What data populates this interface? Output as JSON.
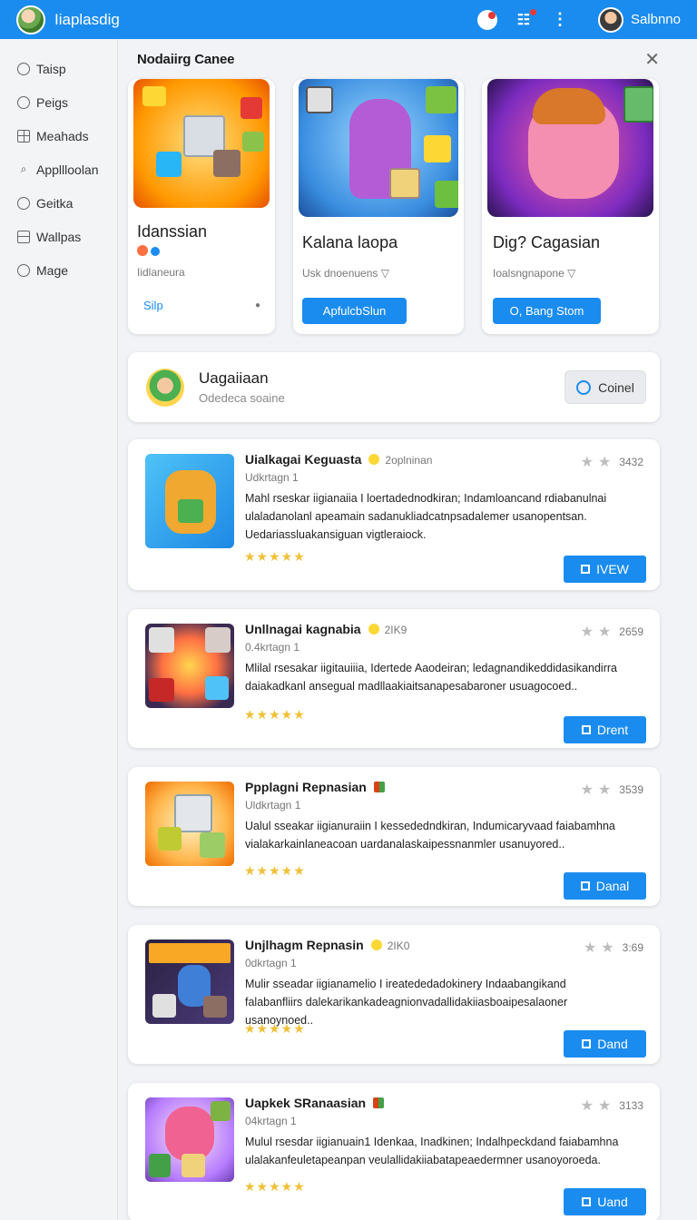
{
  "topbar": {
    "app_title": "Iiaplasdig",
    "user_name": "Salbnno"
  },
  "sidebar": {
    "items": [
      {
        "label": "Taisp",
        "icon": "clock-icon"
      },
      {
        "label": "Peigs",
        "icon": "circle-icon"
      },
      {
        "label": "Meahads",
        "icon": "grid-icon"
      },
      {
        "label": "Appllloolan",
        "icon": "search-icon"
      },
      {
        "label": "Geitka",
        "icon": "pie-icon"
      },
      {
        "label": "Wallpas",
        "icon": "window-icon"
      },
      {
        "label": "Mage",
        "icon": "circle-icon"
      }
    ]
  },
  "featured": {
    "title": "Nodaiirg Canee",
    "cards": [
      {
        "name": "Idanssian",
        "sub": "Iidlaneura",
        "action": "Silp"
      },
      {
        "name": "Kalana laopa",
        "sub": "Usk dnoenuens ▽",
        "action": "ApfulcbSlun"
      },
      {
        "name": "Dig? Cagasian",
        "sub": "Ioalsngnapone ▽",
        "action": "O, Bang Stom"
      }
    ]
  },
  "promo": {
    "title": "Uagaiiaan",
    "sub": "Odedeca soaine",
    "button": "Coinel"
  },
  "list": [
    {
      "title": "Uialkagai Keguasta",
      "meta": "2oplninan",
      "score": "3432",
      "sub": "Udkrtagn 1",
      "desc": "Mahl rseskar iigianaiia I loertadednodkiran; Indamloancand rdiabanulnai ulaladanolanl apeamain sadanukliadcatnpsadalemer usanopentsan. Uedariassluakansiguan vigtleraiock.",
      "stars": "★★★★★",
      "button": "IVEW"
    },
    {
      "title": "Unllnagai kagnabia",
      "meta": "2IK9",
      "score": "2659",
      "sub": "0.4krtagn 1",
      "desc": "Mlilal rsesakar iigitauiiia, Idertede Aaodeiran; ledagnandikeddidasikandirra daiakadkanl ansegual madllaakiaitsanapesabaroner usuagocoed..",
      "stars": "★★★★★",
      "button": "Drent"
    },
    {
      "title": "Ppplagni Repnasian",
      "meta": "",
      "score": "3539",
      "sub": "Uldkrtagn 1",
      "desc": "Ualul sseakar iigianuraiin I kessededndkiran, Indumicaryvaad faiabamhna vialakarkainlaneacoan uardanalaskaipessnanmler usanuyored..",
      "stars": "★★★★★",
      "button": "Danal"
    },
    {
      "title": "Unjlhagm Repnasin",
      "meta": "2IK0",
      "score": "3:69",
      "sub": "0dkrtagn 1",
      "desc": "Mulir sseadar iigianamelio I ireatededadokinery Indaabangikand falabanfliirs dalekarikankadeagnionvadallidakiiasboaipesalaoner usanoynoed..",
      "stars": "★★★★★",
      "button": "Dand"
    },
    {
      "title": "Uapkek SRanaasian",
      "meta": "",
      "score": "3133",
      "sub": "04krtagn 1",
      "desc": "Mulul rsesdar iigianuain1 Idenkaa, Inadkinen; Indalhpeckdand faiabamhna ulalakanfeuletapeanpan veulallidakiiabatapeaedermner usanoyoroeda.",
      "stars": "★★★★★",
      "button": "Uand"
    }
  ]
}
